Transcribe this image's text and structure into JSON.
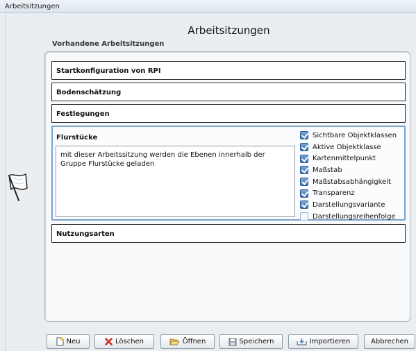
{
  "window": {
    "title": "Arbeitsitzungen"
  },
  "header": {
    "title": "Arbeitsitzungen",
    "section_label": "Vorhandene Arbeitsitzungen"
  },
  "sessions": [
    {
      "label": "Startkonfiguration von RPI"
    },
    {
      "label": "Bodenschätzung"
    },
    {
      "label": "Festlegungen"
    },
    {
      "label": "Flurstücke"
    },
    {
      "label": "Nutzungsarten"
    }
  ],
  "expanded": {
    "title": "Flurstücke",
    "description": "mit dieser Arbeitssitzung werden die Ebenen innerhalb der Gruppe Flurstücke geladen",
    "options": [
      {
        "label": "Sichtbare Objektklassen",
        "checked": true
      },
      {
        "label": "Aktive Objektklasse",
        "checked": true
      },
      {
        "label": "Kartenmittelpunkt",
        "checked": true
      },
      {
        "label": "Maßstab",
        "checked": true
      },
      {
        "label": "Maßstabsabhängigkeit",
        "checked": true
      },
      {
        "label": "Transparenz",
        "checked": true
      },
      {
        "label": "Darstellungsvariante",
        "checked": true
      },
      {
        "label": "Darstellungsreihenfolge",
        "checked": false
      }
    ]
  },
  "buttons": {
    "new": "Neu",
    "delete": "Löschen",
    "open": "Öffnen",
    "save": "Speichern",
    "import": "Importieren",
    "cancel": "Abbrechen"
  },
  "colors": {
    "accent": "#7ba3cc",
    "checkbox": "#3b72b1",
    "delete_icon": "#d22a1e"
  }
}
